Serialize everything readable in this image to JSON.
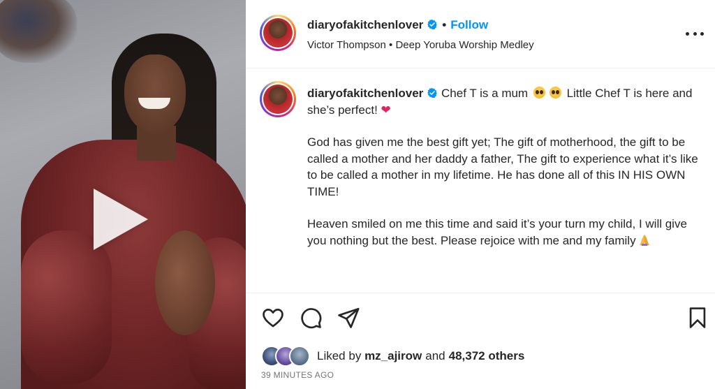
{
  "post": {
    "username": "diaryofakitchenlover",
    "separator": "•",
    "follow_label": "Follow",
    "audio": {
      "artist": "Victor Thompson",
      "separator": "•",
      "track": "Deep Yoruba Worship Medley"
    }
  },
  "caption": {
    "username": "diaryofakitchenlover",
    "line1_text": "Chef T is a mum",
    "line1_text_b": "Little Chef T is here and she’s perfect!",
    "heart": "❤",
    "paragraph2": "God has given me the best gift yet; The gift of motherhood, the gift to be called a mother and her daddy a father, The gift to experience what it’s like to be called a mother in my lifetime. He has done all of this IN HIS OWN TIME!",
    "paragraph3": "Heaven smiled on me this time and said it’s your turn my child, I will give you nothing but the best. Please rejoice with me and my family"
  },
  "likes": {
    "prefix": "Liked by",
    "top_user": "mz_ajirow",
    "and": "and",
    "others": "48,372 others"
  },
  "timestamp": "39 MINUTES AGO",
  "colors": {
    "accent": "#0095f6",
    "text": "#262626",
    "muted": "#737373",
    "verified": "#0095f6",
    "heart": "#e0245e"
  },
  "icons": {
    "like": "heart-outline-icon",
    "comment": "comment-bubble-icon",
    "share": "paper-plane-icon",
    "save": "bookmark-icon",
    "more": "more-horizontal-icon",
    "verified": "verified-badge-icon",
    "play": "play-icon"
  }
}
